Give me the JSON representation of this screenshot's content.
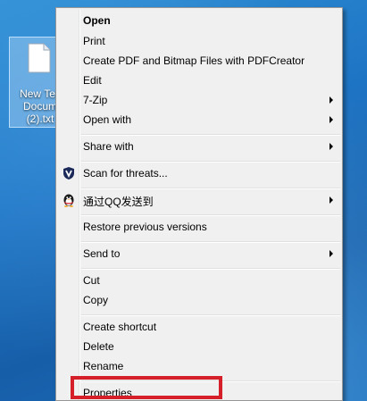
{
  "desktop": {
    "file_icon": {
      "label_lines": [
        "New Tex",
        "Docum",
        "(2).txt"
      ]
    }
  },
  "context_menu": {
    "items": [
      {
        "label": "Open",
        "bold": true
      },
      {
        "label": "Print"
      },
      {
        "label": "Create PDF and Bitmap Files with PDFCreator"
      },
      {
        "label": "Edit"
      },
      {
        "label": "7-Zip",
        "submenu": true
      },
      {
        "label": "Open with",
        "submenu": true
      },
      {
        "label": "Share with",
        "submenu": true
      },
      {
        "label": "Scan for threats...",
        "icon": "shield-icon"
      },
      {
        "label": "通过QQ发送到",
        "icon": "qq-penguin-icon",
        "submenu": true
      },
      {
        "label": "Restore previous versions"
      },
      {
        "label": "Send to",
        "submenu": true
      },
      {
        "label": "Cut"
      },
      {
        "label": "Copy"
      },
      {
        "label": "Create shortcut"
      },
      {
        "label": "Delete"
      },
      {
        "label": "Rename"
      },
      {
        "label": "Properties",
        "highlighted": true
      }
    ]
  },
  "annotation": {
    "highlight_color": "#d5202a",
    "highlighted_item": "Properties"
  }
}
